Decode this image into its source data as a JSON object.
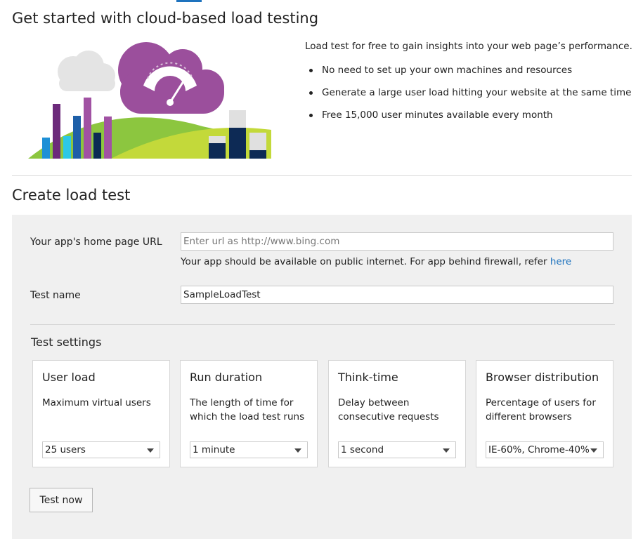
{
  "hero": {
    "title": "Get started with cloud-based load testing",
    "intro": "Load test for free to gain insights into your web page’s performance.",
    "bullets": [
      "No need to set up your own machines and resources",
      "Generate a large user load hitting your website at the same time",
      "Free 15,000 user minutes available every month"
    ]
  },
  "create": {
    "title": "Create load test",
    "url_label": "Your app's home page URL",
    "url_value": "",
    "url_placeholder": "Enter url as http://www.bing.com",
    "url_hint": "Your app should be available on public internet. For app behind firewall, refer ",
    "url_hint_link": "here",
    "name_label": "Test name",
    "name_value": "SampleLoadTest"
  },
  "settings": {
    "title": "Test settings",
    "cards": [
      {
        "title": "User load",
        "desc": "Maximum virtual users",
        "selected": "25 users"
      },
      {
        "title": "Run duration",
        "desc": "The length of time for which the load test runs",
        "selected": "1 minute"
      },
      {
        "title": "Think-time",
        "desc": "Delay between consecutive requests",
        "selected": "1 second"
      },
      {
        "title": "Browser distribution",
        "desc": "Percentage of users for different browsers",
        "selected": "IE-60%, Chrome-40%"
      }
    ]
  },
  "actions": {
    "test_now": "Test now"
  },
  "colors": {
    "accent": "#1e73be",
    "panel_bg": "#f0f0f0",
    "cloud_purple": "#9b4f9c",
    "hill_green": "#8cc63f"
  }
}
